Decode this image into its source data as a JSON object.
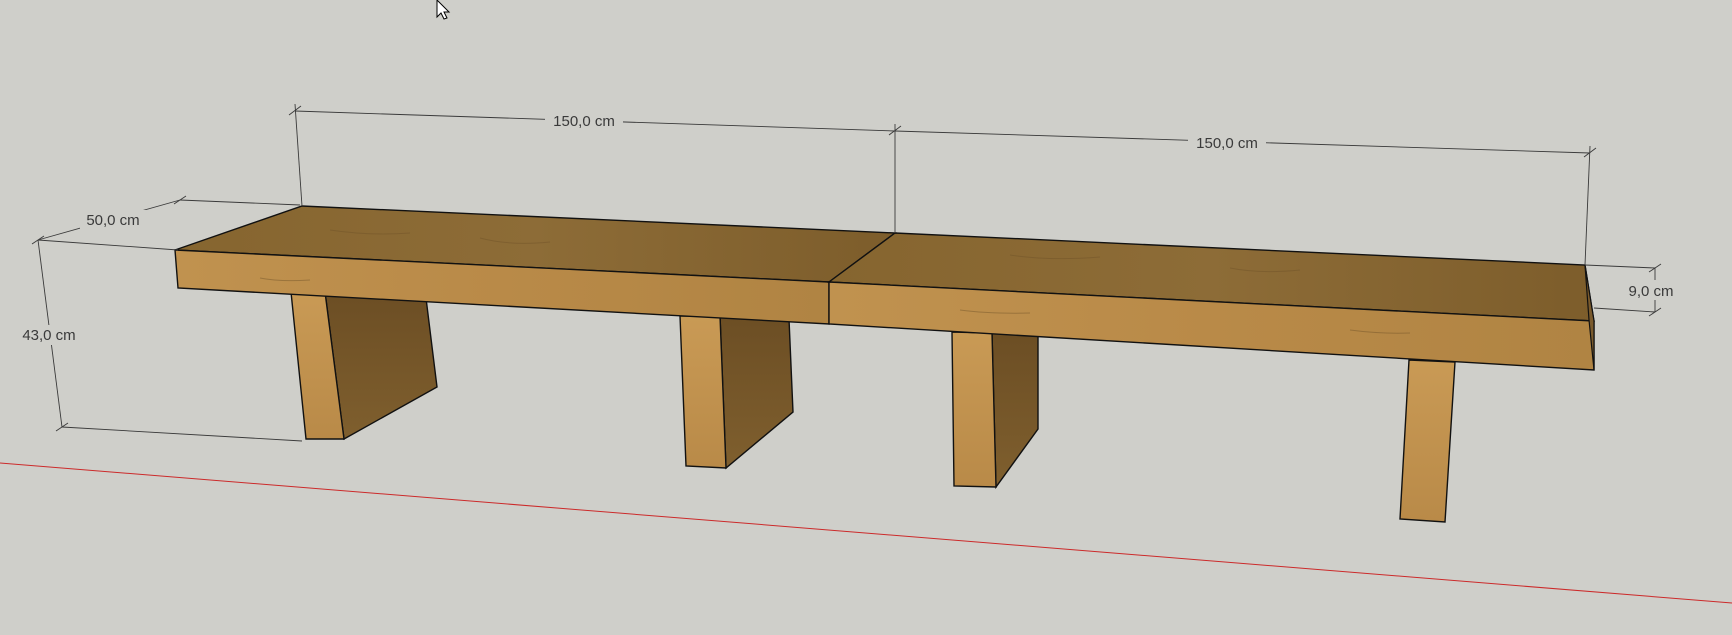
{
  "viewport": {
    "background_color": "#cfcfca",
    "axis_color": "#cc2a2a"
  },
  "cursor": {
    "icon": "arrow-pointer-icon"
  },
  "dimensions": {
    "length_left": "150,0 cm",
    "length_right": "150,0 cm",
    "width": "50,0 cm",
    "height": "43,0 cm",
    "thickness": "9,0 cm"
  },
  "materials": {
    "wood_top": "#8a6a36",
    "wood_front": "#b98c4c",
    "wood_side": "#7a5a2c",
    "edge_color": "#111111"
  }
}
